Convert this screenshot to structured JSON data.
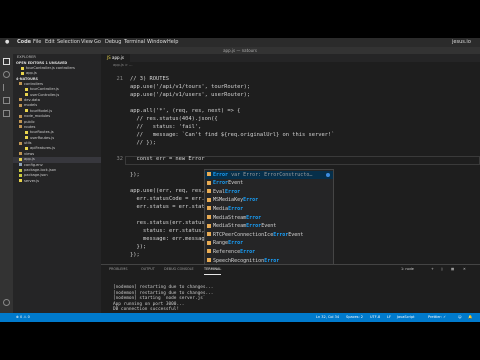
{
  "menubar": {
    "app_name": "Code",
    "items": [
      "File",
      "Edit",
      "Selection",
      "View",
      "Go",
      "Debug",
      "Terminal",
      "Window",
      "Help"
    ],
    "right_text": "jesus.io"
  },
  "titlebar": {
    "title": "app.js — natours"
  },
  "sidebar": {
    "header": "EXPLORER",
    "open_editors_section": "OPEN EDITORS  1 UNSAVED",
    "open_editors": [
      "tourController.js  controllers",
      "app.js"
    ],
    "project_section": "4-NATOURS",
    "files": [
      "controllers",
      "tourController.js",
      "userController.js",
      "dev-data",
      "models",
      "tourModel.js",
      "node_modules",
      "public",
      "routes",
      "tourRoutes.js",
      "userRoutes.js",
      "utils",
      "apiFeatures.js",
      "views",
      "app.js",
      "config.env",
      "package-lock.json",
      "package.json",
      "server.js"
    ],
    "selected_index": 14
  },
  "tab": {
    "label": "app.js"
  },
  "breadcrumb": "app.js > ...",
  "editor": {
    "lines": [
      {
        "n": "21",
        "code": "// 3) ROUTES",
        "cls": "c-com"
      },
      {
        "n": "",
        "code": "app.use('/api/v1/tours', tourRouter);",
        "cls": ""
      },
      {
        "n": "",
        "code": "app.use('/api/v1/users', userRouter);",
        "cls": ""
      },
      {
        "n": "",
        "code": "",
        "cls": ""
      },
      {
        "n": "",
        "code": "app.all('*', (req, res, next) => {",
        "cls": ""
      },
      {
        "n": "",
        "code": "  // res.status(404).json({",
        "cls": "c-com"
      },
      {
        "n": "",
        "code": "  //   status: 'fail',",
        "cls": "c-com"
      },
      {
        "n": "",
        "code": "  //   message: `Can't find ${req.originalUrl} on this server!`",
        "cls": "c-com"
      },
      {
        "n": "",
        "code": "  // });",
        "cls": "c-com"
      },
      {
        "n": "",
        "code": "",
        "cls": ""
      },
      {
        "n": "32",
        "code": "  const err = new Error",
        "cls": ""
      },
      {
        "n": "",
        "code": "",
        "cls": ""
      },
      {
        "n": "",
        "code": "});",
        "cls": ""
      },
      {
        "n": "",
        "code": "",
        "cls": ""
      },
      {
        "n": "",
        "code": "app.use((err, req, res,",
        "cls": ""
      },
      {
        "n": "",
        "code": "  err.statusCode = err.",
        "cls": ""
      },
      {
        "n": "",
        "code": "  err.status = err.status",
        "cls": ""
      },
      {
        "n": "",
        "code": "",
        "cls": ""
      },
      {
        "n": "",
        "code": "  res.status(err.statusCo",
        "cls": ""
      },
      {
        "n": "",
        "code": "    status: err.status,",
        "cls": ""
      },
      {
        "n": "",
        "code": "    message: err.messag",
        "cls": ""
      },
      {
        "n": "",
        "code": "  });",
        "cls": ""
      },
      {
        "n": "",
        "code": "});",
        "cls": ""
      }
    ]
  },
  "suggestions": {
    "items": [
      {
        "label": "Error",
        "detail": " var Error: ErrorConstructo…"
      },
      {
        "label": "ErrorEvent",
        "detail": ""
      },
      {
        "label": "EvalError",
        "detail": ""
      },
      {
        "label": "MSMediaKeyError",
        "detail": ""
      },
      {
        "label": "MediaError",
        "detail": ""
      },
      {
        "label": "MediaStreamError",
        "detail": ""
      },
      {
        "label": "MediaStreamErrorEvent",
        "detail": ""
      },
      {
        "label": "RTCPeerConnectionIceErrorEvent",
        "detail": ""
      },
      {
        "label": "RangeError",
        "detail": ""
      },
      {
        "label": "ReferenceError",
        "detail": ""
      },
      {
        "label": "SpeechRecognitionError",
        "detail": ""
      }
    ],
    "selected_index": 0
  },
  "panel": {
    "tabs": [
      "PROBLEMS",
      "OUTPUT",
      "DEBUG CONSOLE",
      "TERMINAL"
    ],
    "active_tab": 3,
    "terminal_select": "1: node",
    "terminal_lines": [
      "[nodemon] restarting due to changes...",
      "[nodemon] restarting due to changes...",
      "[nodemon] starting `node server.js`",
      "App running on port 3000...",
      "DB connection successful!"
    ]
  },
  "statusbar": {
    "left": "⊗ 0 ⚠ 0",
    "position": "Ln 32, Col 34",
    "spaces": "Spaces: 2",
    "encoding": "UTF-8",
    "eol": "LF",
    "language": "JavaScript",
    "prettier": "Prettier: ✓"
  },
  "colors": {
    "accent": "#007acc",
    "selection": "#062f4a",
    "match": "#18a3ff"
  }
}
